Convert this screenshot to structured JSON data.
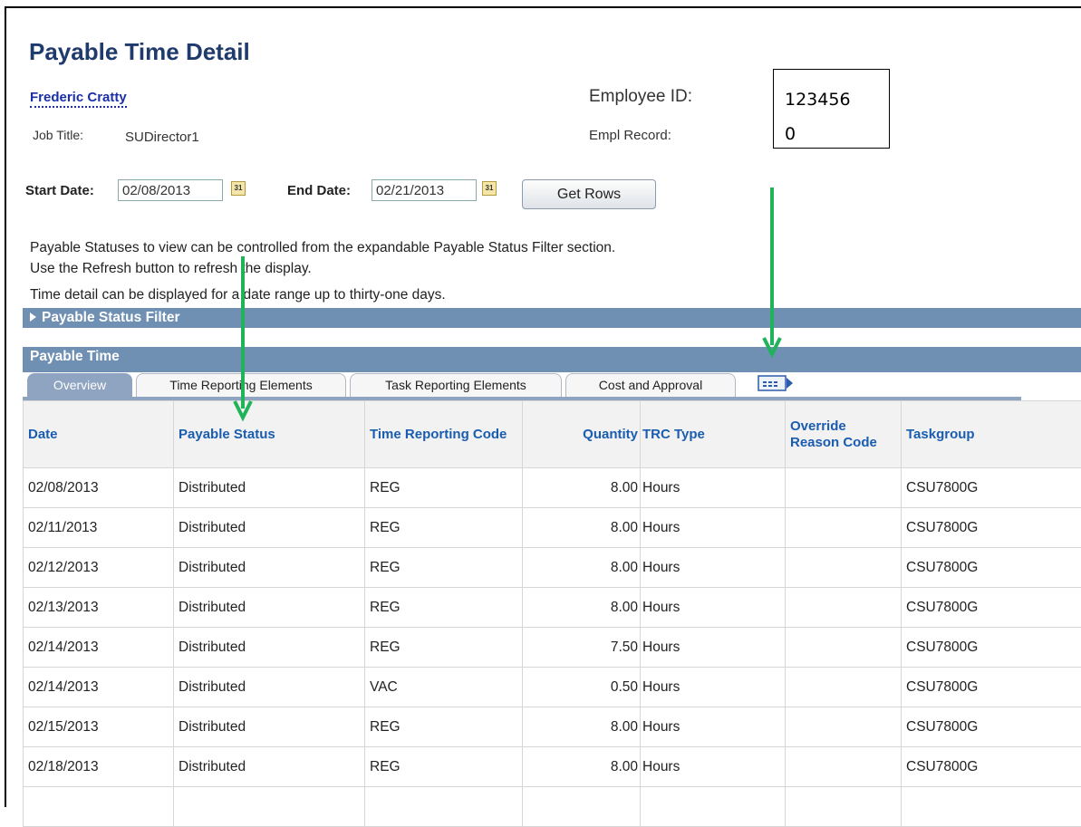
{
  "page": {
    "title": "Payable Time Detail",
    "employee_name": "Frederic Cratty",
    "job_title_label": "Job Title:",
    "job_title_value": "SUDirector1",
    "employee_id_label": "Employee ID:",
    "empl_record_label": "Empl Record:",
    "employee_id_value": "123456",
    "empl_record_value": "0"
  },
  "filters": {
    "start_label": "Start Date:",
    "start_value": "02/08/2013",
    "end_label": "End Date:",
    "end_value": "02/21/2013",
    "calendar_glyph": "31",
    "get_rows_label": "Get Rows"
  },
  "info": {
    "line1": "Payable Statuses to view can be controlled from the expandable Payable Status Filter section.",
    "line2": "Use the Refresh button to refresh the display.",
    "line3": "Time detail can be displayed for a date range up to thirty-one days."
  },
  "sections": {
    "status_filter": "Payable Status Filter",
    "payable_time": "Payable Time"
  },
  "tabs": [
    {
      "label": "Overview",
      "active": true
    },
    {
      "label": "Time Reporting Elements",
      "active": false
    },
    {
      "label": "Task Reporting Elements",
      "active": false
    },
    {
      "label": "Cost and Approval",
      "active": false
    }
  ],
  "icons": {
    "expand": "triangle-right-icon",
    "show_all_columns": "show-all-columns-icon",
    "calendar": "calendar-icon",
    "annotation_arrow": "arrow-down-icon"
  },
  "colors": {
    "title": "#1f3a6d",
    "header_text": "#1a5db0",
    "section_bar": "#6f8fb3",
    "annotation_arrow": "#1fb35a"
  },
  "table": {
    "headers": {
      "date": "Date",
      "status": "Payable Status",
      "trc": "Time Reporting Code",
      "qty": "Quantity",
      "type": "TRC Type",
      "override": "Override Reason Code",
      "taskgroup": "Taskgroup"
    },
    "rows": [
      {
        "date": "02/08/2013",
        "status": "Distributed",
        "trc": "REG",
        "qty": "8.00",
        "type": "Hours",
        "override": "",
        "taskgroup": "CSU7800G"
      },
      {
        "date": "02/11/2013",
        "status": "Distributed",
        "trc": "REG",
        "qty": "8.00",
        "type": "Hours",
        "override": "",
        "taskgroup": "CSU7800G"
      },
      {
        "date": "02/12/2013",
        "status": "Distributed",
        "trc": "REG",
        "qty": "8.00",
        "type": "Hours",
        "override": "",
        "taskgroup": "CSU7800G"
      },
      {
        "date": "02/13/2013",
        "status": "Distributed",
        "trc": "REG",
        "qty": "8.00",
        "type": "Hours",
        "override": "",
        "taskgroup": "CSU7800G"
      },
      {
        "date": "02/14/2013",
        "status": "Distributed",
        "trc": "REG",
        "qty": "7.50",
        "type": "Hours",
        "override": "",
        "taskgroup": "CSU7800G"
      },
      {
        "date": "02/14/2013",
        "status": "Distributed",
        "trc": "VAC",
        "qty": "0.50",
        "type": "Hours",
        "override": "",
        "taskgroup": "CSU7800G"
      },
      {
        "date": "02/15/2013",
        "status": "Distributed",
        "trc": "REG",
        "qty": "8.00",
        "type": "Hours",
        "override": "",
        "taskgroup": "CSU7800G"
      },
      {
        "date": "02/18/2013",
        "status": "Distributed",
        "trc": "REG",
        "qty": "8.00",
        "type": "Hours",
        "override": "",
        "taskgroup": "CSU7800G"
      }
    ]
  }
}
